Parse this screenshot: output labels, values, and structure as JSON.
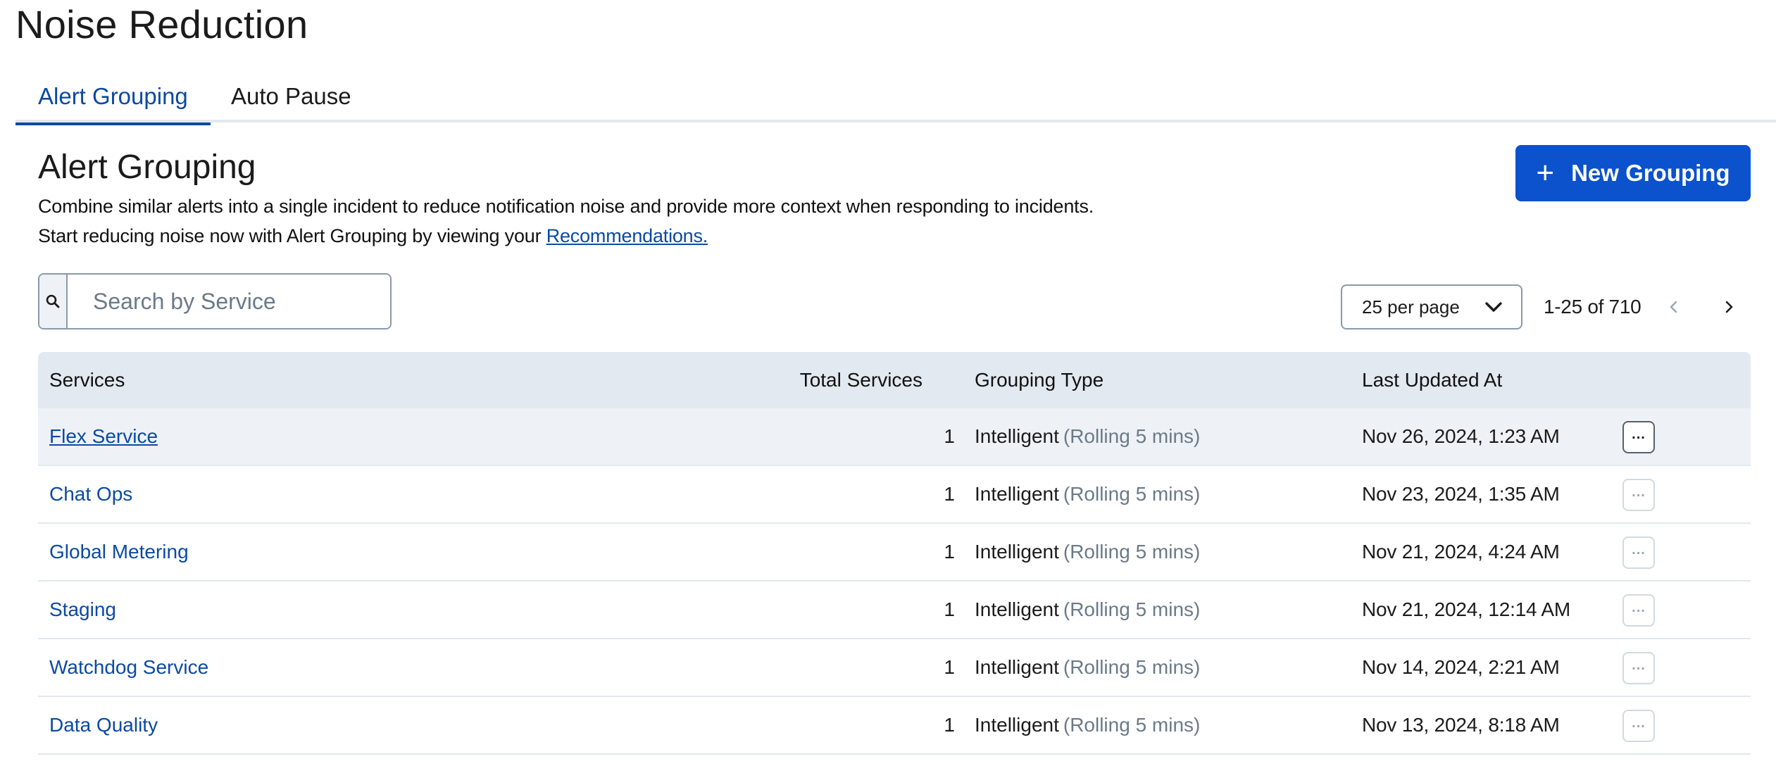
{
  "page": {
    "title": "Noise Reduction"
  },
  "tabs": [
    {
      "label": "Alert Grouping",
      "active": true
    },
    {
      "label": "Auto Pause",
      "active": false
    }
  ],
  "section": {
    "title": "Alert Grouping",
    "description_1": "Combine similar alerts into a single incident to reduce notification noise and provide more context when responding to incidents.",
    "description_2_prefix": "Start reducing noise now with Alert Grouping by viewing your ",
    "description_2_link": "Recommendations."
  },
  "actions": {
    "new_grouping_label": "New Grouping"
  },
  "search": {
    "placeholder": "Search by Service",
    "value": ""
  },
  "pagination": {
    "per_page_label": "25 per page",
    "range_label": "1-25 of 710"
  },
  "table": {
    "headers": {
      "services": "Services",
      "total_services": "Total Services",
      "grouping_type": "Grouping Type",
      "last_updated": "Last Updated At"
    },
    "rows": [
      {
        "service": "Flex Service",
        "total": "1",
        "type": "Intelligent",
        "type_detail": "(Rolling 5 mins)",
        "updated": "Nov 26, 2024, 1:23 AM"
      },
      {
        "service": "Chat Ops",
        "total": "1",
        "type": "Intelligent",
        "type_detail": "(Rolling 5 mins)",
        "updated": "Nov 23, 2024, 1:35 AM"
      },
      {
        "service": "Global Metering",
        "total": "1",
        "type": "Intelligent",
        "type_detail": "(Rolling 5 mins)",
        "updated": "Nov 21, 2024, 4:24 AM"
      },
      {
        "service": "Staging",
        "total": "1",
        "type": "Intelligent",
        "type_detail": "(Rolling 5 mins)",
        "updated": "Nov 21, 2024, 12:14 AM"
      },
      {
        "service": "Watchdog Service",
        "total": "1",
        "type": "Intelligent",
        "type_detail": "(Rolling 5 mins)",
        "updated": "Nov 14, 2024, 2:21 AM"
      },
      {
        "service": "Data Quality",
        "total": "1",
        "type": "Intelligent",
        "type_detail": "(Rolling 5 mins)",
        "updated": "Nov 13, 2024, 8:18 AM"
      }
    ]
  },
  "colors": {
    "accent": "#0b52cc",
    "link": "#0b4aa2",
    "header_bg": "#e3e9f0",
    "muted": "#6b7a88"
  },
  "icons": {
    "search": "search-icon",
    "chevron": "chevron-down-icon",
    "prev": "chevron-left-icon",
    "next": "chevron-right-icon",
    "more": "more-horizontal-icon",
    "plus": "plus-icon"
  }
}
